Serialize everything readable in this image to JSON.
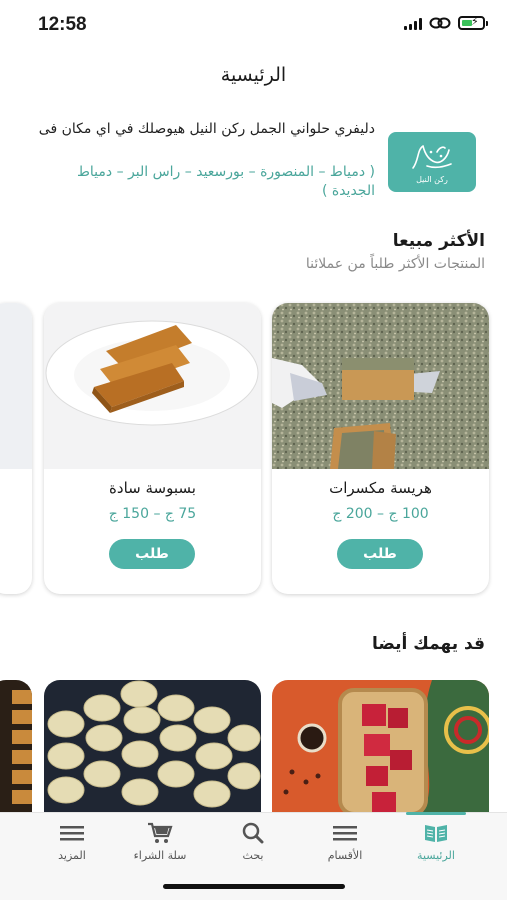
{
  "status_bar": {
    "time": "12:58"
  },
  "header": {
    "title": "الرئيسية"
  },
  "delivery": {
    "logo_text": "ركن النيل",
    "text": "دليفري حلواني الجمل ركن النيل هيوصلك في اي مكان فى",
    "cities": "( دمياط – المنصورة – بورسعيد – راس البر – دمياط الجديدة )"
  },
  "best_sellers": {
    "title": "الأكثر مبيعا",
    "subtitle": "المنتجات الأكثر طلباً من عملائنا",
    "items": [
      {
        "name": "هريسة مكسرات",
        "price": "100 ج – 200 ج",
        "button": "طلب"
      },
      {
        "name": "بسبوسة سادة",
        "price": "75 ج – 150 ج",
        "button": "طلب"
      }
    ]
  },
  "suggested": {
    "title": "قد يهمك أيضا"
  },
  "tabs": [
    {
      "label": "الرئيسية",
      "icon": "book-icon",
      "active": true
    },
    {
      "label": "الأقسام",
      "icon": "menu-icon",
      "active": false
    },
    {
      "label": "بحث",
      "icon": "search-icon",
      "active": false
    },
    {
      "label": "سلة الشراء",
      "icon": "cart-icon",
      "active": false
    },
    {
      "label": "المزيد",
      "icon": "menu-icon",
      "active": false
    }
  ],
  "colors": {
    "accent": "#4fb3a8",
    "accent_text": "#4aa69b"
  }
}
